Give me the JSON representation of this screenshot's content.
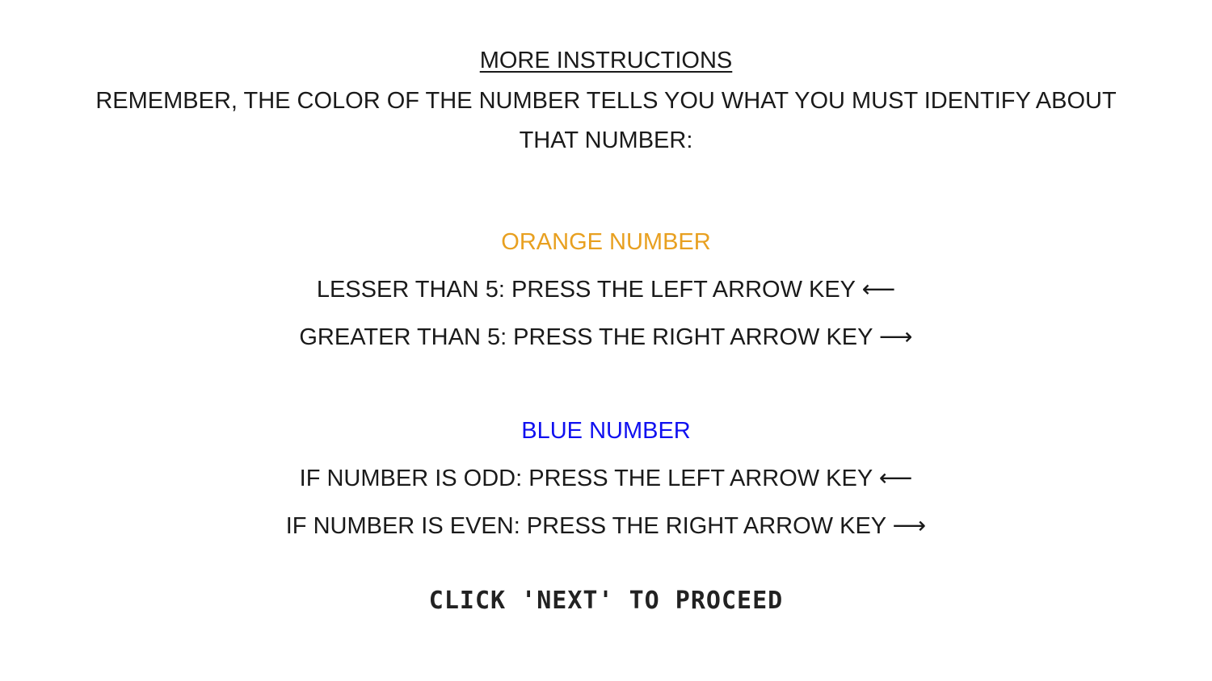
{
  "instructions": {
    "heading": "MORE INSTRUCTIONS",
    "intro": "REMEMBER, THE COLOR OF THE NUMBER TELLS YOU WHAT YOU MUST IDENTIFY ABOUT THAT NUMBER:",
    "orange": {
      "title": "ORANGE NUMBER",
      "color": "#e8a020",
      "rules": [
        {
          "text": "LESSER THAN 5: PRESS THE LEFT ARROW KEY",
          "arrow": "⟵",
          "icon": "left-arrow-icon"
        },
        {
          "text": "GREATER THAN 5: PRESS THE RIGHT ARROW KEY",
          "arrow": "⟶",
          "icon": "right-arrow-icon"
        }
      ]
    },
    "blue": {
      "title": "BLUE NUMBER",
      "color": "#1010f0",
      "rules": [
        {
          "text": "IF NUMBER IS ODD: PRESS THE LEFT ARROW KEY",
          "arrow": "⟵",
          "icon": "left-arrow-icon"
        },
        {
          "text": "IF NUMBER IS EVEN: PRESS THE RIGHT ARROW KEY",
          "arrow": "⟶",
          "icon": "right-arrow-icon"
        }
      ]
    },
    "proceed": "CLICK 'NEXT' TO PROCEED"
  }
}
